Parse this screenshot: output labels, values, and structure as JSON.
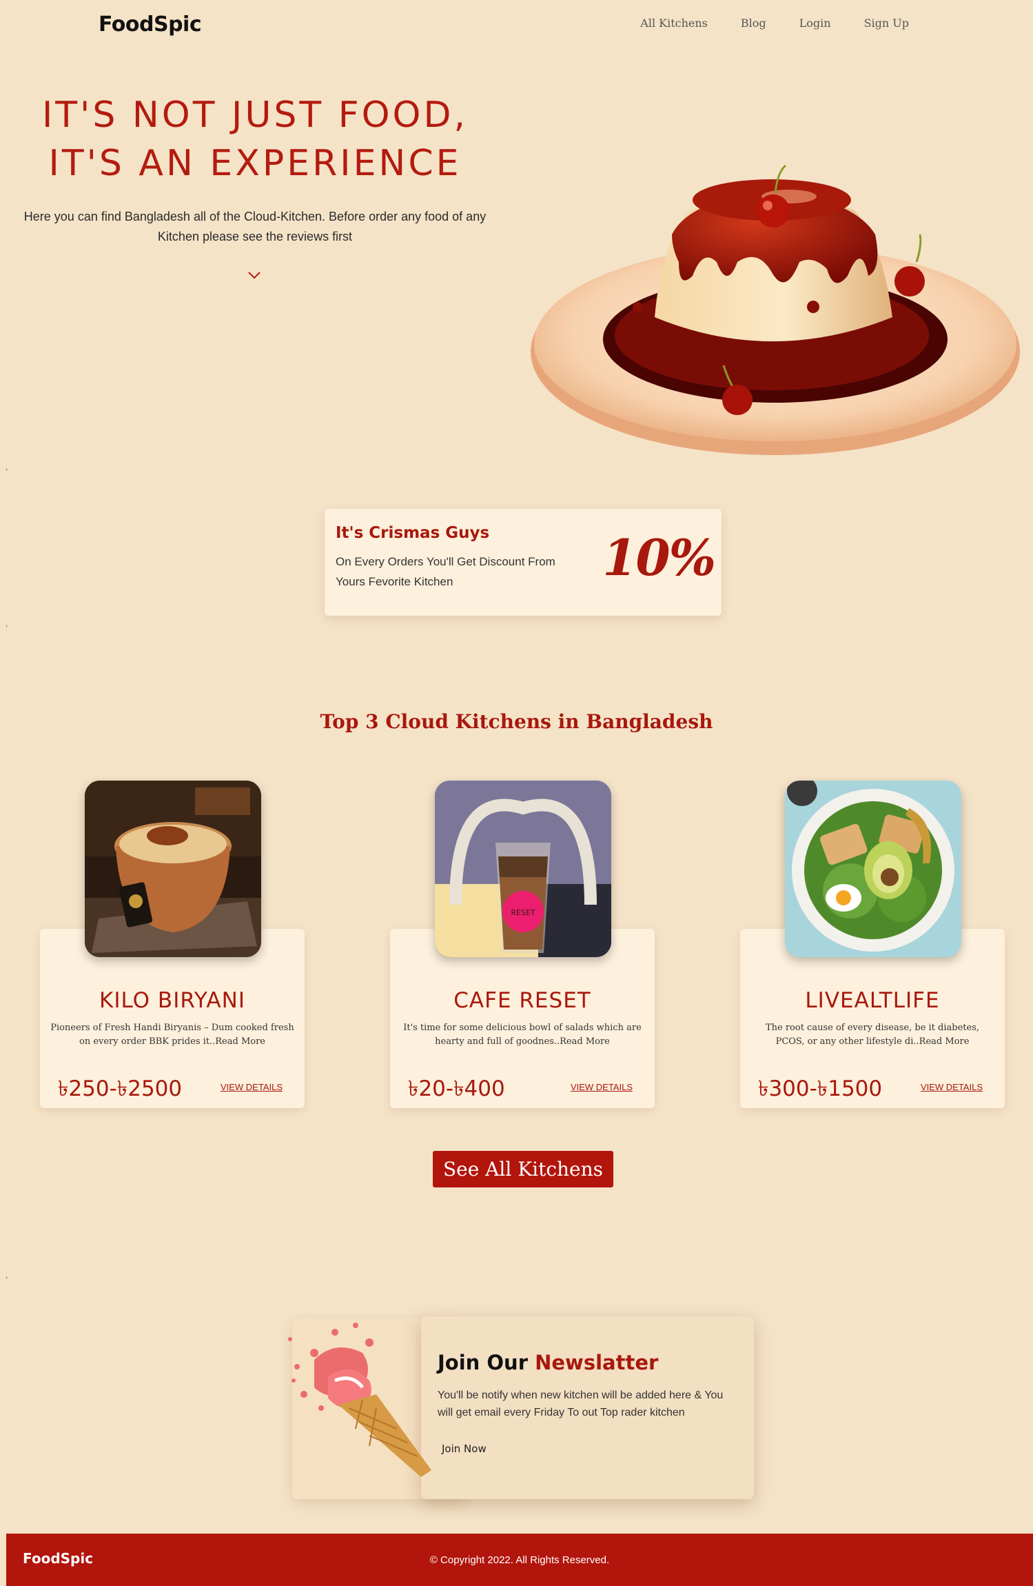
{
  "nav": {
    "logo": "FoodSpic",
    "links": [
      "All Kitchens",
      "Blog",
      "Login",
      "Sign Up"
    ]
  },
  "hero": {
    "title_line1": "IT'S NOT JUST FOOD,",
    "title_line2": "IT'S AN EXPERIENCE",
    "description": "Here you can find Bangladesh all of the Cloud-Kitchen. Before order any food of any Kitchen please see the reviews first",
    "scroll_icon": "chevron-down-icon",
    "image": "caramel-pudding-with-cherries"
  },
  "markers": [
    ",",
    ",",
    ","
  ],
  "promo": {
    "title": "It's Crismas Guys",
    "text": "On Every Orders You'll Get Discount From Yours Fevorite Kitchen",
    "discount": "10%"
  },
  "top_kitchens": {
    "title": "Top 3 Cloud Kitchens in Bangladesh",
    "items": [
      {
        "name": "KILO BIRYANI",
        "description": "Pioneers of Fresh Handi Biryanis – Dum cooked fresh on every order BBK prides it..Read More",
        "price": "৳250-৳2500",
        "action": "VIEW DETAILS",
        "image": "biryani-clay-pot"
      },
      {
        "name": "CAFE RESET",
        "description": "It's time for some delicious bowl of salads which are hearty and full of goodnes..Read More",
        "price": "৳20-৳400",
        "action": "VIEW DETAILS",
        "image": "iced-coffee-cup"
      },
      {
        "name": "LIVEALTLIFE",
        "description": "The root cause of every disease, be it diabetes, PCOS, or any other lifestyle di..Read More",
        "price": "৳300-৳1500",
        "action": "VIEW DETAILS",
        "image": "salad-bowl"
      }
    ],
    "see_all": "See All Kitchens"
  },
  "newsletter": {
    "title_part1": "Join Our",
    "title_part2": "Newslatter",
    "text": "You'll be notify when new kitchen will be added here & You will get email every Friday To out Top rader kitchen",
    "button": "Join Now",
    "image": "ice-cream-cone-splash"
  },
  "footer": {
    "logo": "FoodSpic",
    "copyright": "© Copyright 2022. All Rights Reserved."
  },
  "colors": {
    "background": "#f5e3c8",
    "card": "#fdf0dc",
    "accent": "#a8180d",
    "footer": "#b2150c"
  }
}
